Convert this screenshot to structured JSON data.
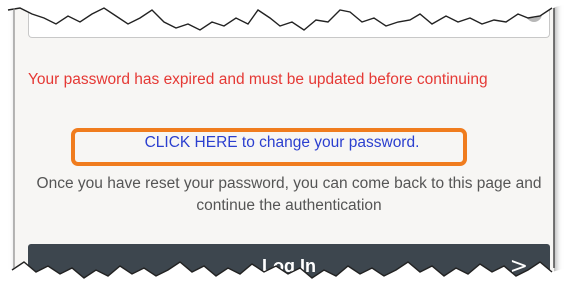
{
  "password_field": {
    "value_masked": "•••"
  },
  "messages": {
    "error": "Your password has expired and must be updated before continuing",
    "change_link": "CLICK HERE to change your password.",
    "info": "Once you have reset your password, you can come back to this page and continue the authentication"
  },
  "login_button": {
    "label": "Log In",
    "chevron": ">"
  },
  "colors": {
    "error": "#e53935",
    "link": "#2b3fcf",
    "highlight": "#f07c1e",
    "button_bg": "#3d464e"
  },
  "icons": [
    "eye-icon",
    "chevron-right-icon"
  ]
}
